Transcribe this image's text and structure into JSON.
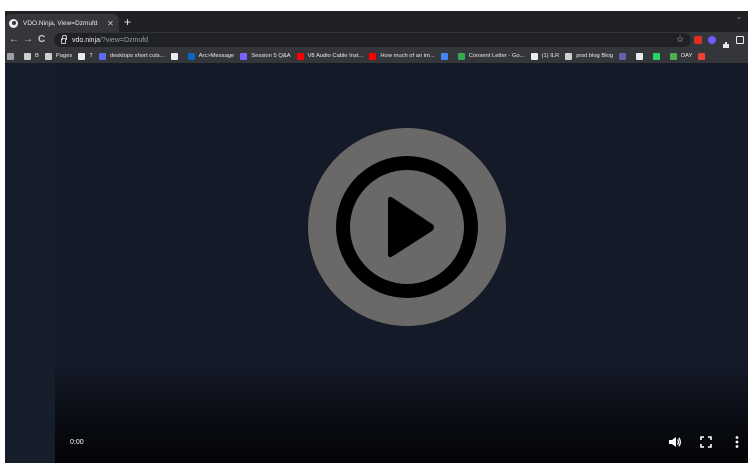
{
  "browser": {
    "tab": {
      "title": "VDO.Ninja, View=Dzmufd",
      "close_icon": "close-icon",
      "favicon": "vdo-ninja-favicon"
    },
    "new_tab_label": "+",
    "tab_search_label": "⌄",
    "address": {
      "host": "vdo.ninja",
      "path": "/?view=Dzmufd"
    },
    "nav_icons": {
      "back": "←",
      "forward": "→",
      "reload": "C"
    },
    "bookmark_star": "☆",
    "bookmarks": [
      {
        "label": "",
        "color": "#9aa0a6"
      },
      {
        "label": "B",
        "color": "#cfcfcf"
      },
      {
        "label": "Pages",
        "color": "#cfcfcf"
      },
      {
        "label": "T",
        "color": "#e8eaed"
      },
      {
        "label": "desktops short cuts...",
        "color": "#5b6cf0"
      },
      {
        "label": "",
        "color": "#e8eaed"
      },
      {
        "label": "Arc>Message",
        "color": "#0a66c2"
      },
      {
        "label": "Session 5 Q&A",
        "color": "#7b61ff"
      },
      {
        "label": "V8 Audio Cable Inst...",
        "color": "#ff0000"
      },
      {
        "label": "How much of an im...",
        "color": "#ff0000"
      },
      {
        "label": "",
        "color": "#4285f4"
      },
      {
        "label": "Consent Letter - Go...",
        "color": "#34a853"
      },
      {
        "label": "(1) ILR",
        "color": "#e8eaed"
      },
      {
        "label": "post blog Blog",
        "color": "#cfcfcf"
      },
      {
        "label": "",
        "color": "#6264a7"
      },
      {
        "label": "",
        "color": "#e8eaed"
      },
      {
        "label": "",
        "color": "#25d366"
      },
      {
        "label": "DAY",
        "color": "#4caf50"
      },
      {
        "label": "",
        "color": "#ea4335"
      }
    ]
  },
  "video": {
    "time": "0:00",
    "play_icon": "play-icon",
    "volume_icon": "volume-icon",
    "fullscreen_icon": "fullscreen-icon",
    "more_icon": "more-vertical-icon"
  },
  "colors": {
    "page_bg": "#141a28",
    "play_disc": "#6b6868",
    "play_ring": "#000000"
  }
}
